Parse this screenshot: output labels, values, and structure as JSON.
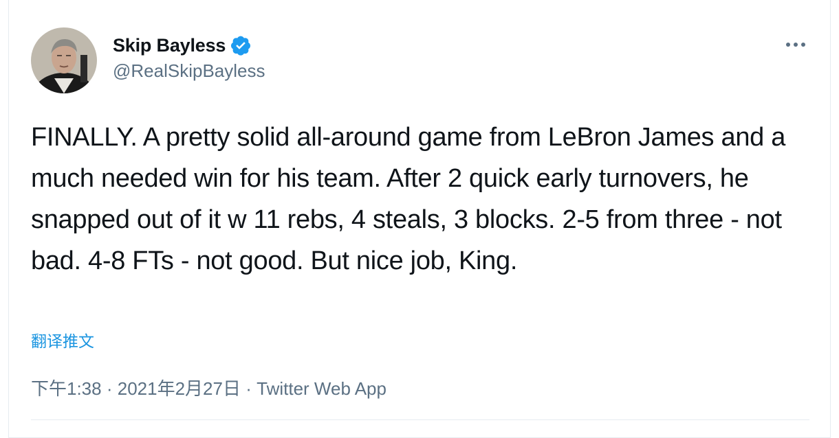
{
  "author": {
    "display_name": "Skip Bayless",
    "handle": "@RealSkipBayless",
    "verified": true
  },
  "icons": {
    "verified": "verified-badge-icon",
    "more": "more-horizontal-icon"
  },
  "colors": {
    "verified_blue": "#1d9bf0",
    "link_blue": "#1b95e0",
    "secondary_text": "#5b7083"
  },
  "tweet": {
    "text": "FINALLY. A pretty solid all-around game from LeBron James and a much needed win for his team. After 2 quick early turnovers, he snapped out of it w 11 rebs, 4 steals, 3 blocks. 2-5 from three - not bad. 4-8 FTs - not good. But nice job, King.",
    "translate_label": "翻译推文",
    "time": "下午1:38",
    "separator": "·",
    "date": "2021年2月27日",
    "source": "Twitter Web App"
  }
}
